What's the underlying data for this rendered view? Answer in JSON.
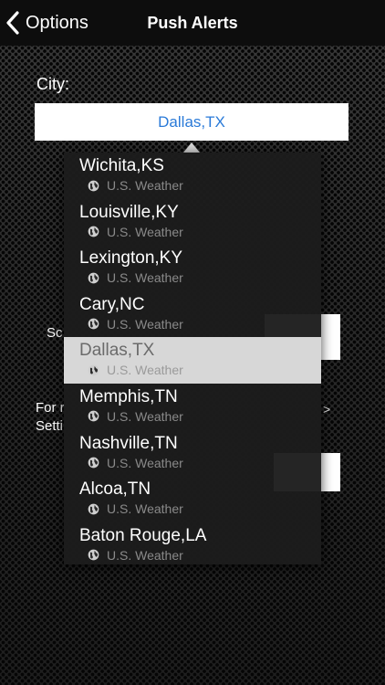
{
  "navbar": {
    "back_label": "Options",
    "title": "Push Alerts"
  },
  "form": {
    "city_label": "City:",
    "city_value": "Dallas,TX"
  },
  "background_fragments": {
    "sc_label": "Sc",
    "for_label": "For r",
    "setti_label": "Setti",
    "arrow": ">"
  },
  "dropdown": {
    "items": [
      {
        "name": "Wichita,KS",
        "source": "U.S. Weather"
      },
      {
        "name": "Louisville,KY",
        "source": "U.S. Weather"
      },
      {
        "name": "Lexington,KY",
        "source": "U.S. Weather"
      },
      {
        "name": "Cary,NC",
        "source": "U.S. Weather"
      },
      {
        "name": "Dallas,TX",
        "source": "U.S. Weather"
      },
      {
        "name": "Memphis,TN",
        "source": "U.S. Weather"
      },
      {
        "name": "Nashville,TN",
        "source": "U.S. Weather"
      },
      {
        "name": "Alcoa,TN",
        "source": "U.S. Weather"
      },
      {
        "name": "Baton Rouge,LA",
        "source": "U.S. Weather"
      }
    ],
    "selected_index": 4
  },
  "icons": {
    "back": "chevron-left-icon",
    "globe": "globe-icon"
  },
  "colors": {
    "city_value": "#2a7ad8",
    "selected_row": "#d7d7d7"
  }
}
